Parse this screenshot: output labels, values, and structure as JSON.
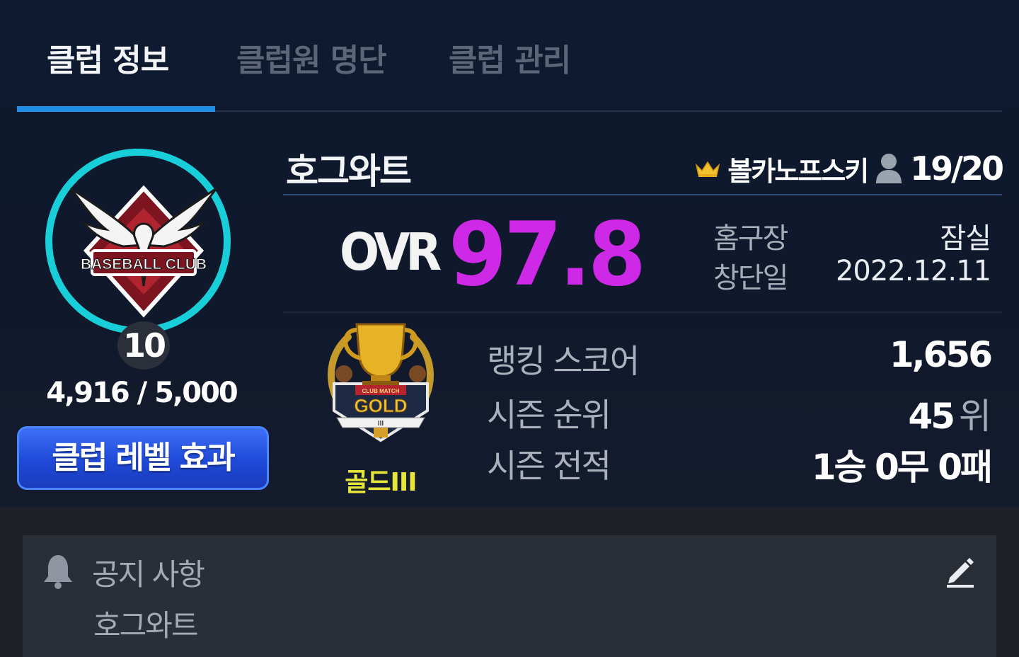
{
  "tabs": [
    {
      "label": "클럽 정보",
      "active": true
    },
    {
      "label": "클럽원 명단",
      "active": false
    },
    {
      "label": "클럽 관리",
      "active": false
    }
  ],
  "emblem": {
    "text": "BASEBALL CLUB",
    "level": "10",
    "exp": "4,916 / 5,000",
    "ring_color": "#18cfd9"
  },
  "level_button": {
    "label": "클럽 레벨 효과"
  },
  "club": {
    "name": "호그와트",
    "owner_icon": "crown-icon",
    "owner": "볼카노프스키",
    "member_icon": "person-icon",
    "members": "19/20"
  },
  "ovr": {
    "label": "OVR",
    "value": "97.8",
    "color": "#cf29e8"
  },
  "info": {
    "home_label": "홈구장",
    "home_value": "잠실",
    "founded_label": "창단일",
    "founded_value": "2022.12.11"
  },
  "tier": {
    "badge_top": "CLUB MATCH",
    "badge_word": "GOLD",
    "badge_sub": "III",
    "name": "골드III",
    "color": "#e6e53a"
  },
  "stats": {
    "ranking_label": "랭킹 스코어",
    "ranking_value": "1,656",
    "season_rank_label": "시즌 순위",
    "season_rank_value": "45",
    "season_rank_unit": "위",
    "season_record_label": "시즌 전적",
    "season_record_value": "1승 0무 0패"
  },
  "notice": {
    "icon": "bell-icon",
    "title": "공지 사항",
    "body": "호그와트",
    "edit_icon": "pencil-icon"
  }
}
